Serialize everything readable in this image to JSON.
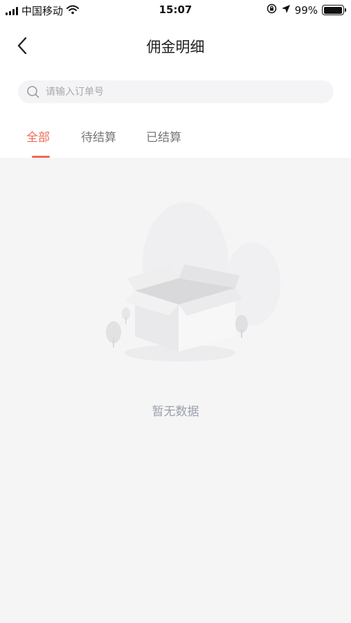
{
  "status_bar": {
    "carrier": "中国移动",
    "time": "15:07",
    "battery": "99%",
    "battery_level": 0.99,
    "icons": [
      "signal-icon",
      "wifi-icon",
      "orientation-lock-icon",
      "location-arrow-icon",
      "battery-icon"
    ]
  },
  "nav": {
    "title": "佣金明细",
    "back_icon": "chevron-left-icon"
  },
  "search": {
    "placeholder": "请输入订单号",
    "value": "",
    "icon": "search-icon"
  },
  "tabs": [
    {
      "label": "全部",
      "active": true
    },
    {
      "label": "待结算",
      "active": false
    },
    {
      "label": "已结算",
      "active": false
    }
  ],
  "empty_state": {
    "text": "暂无数据",
    "illustration": "empty-box-illustration"
  },
  "colors": {
    "accent": "#ee6a55",
    "background": "#f5f5f5",
    "empty_text": "#9aa0ad"
  }
}
